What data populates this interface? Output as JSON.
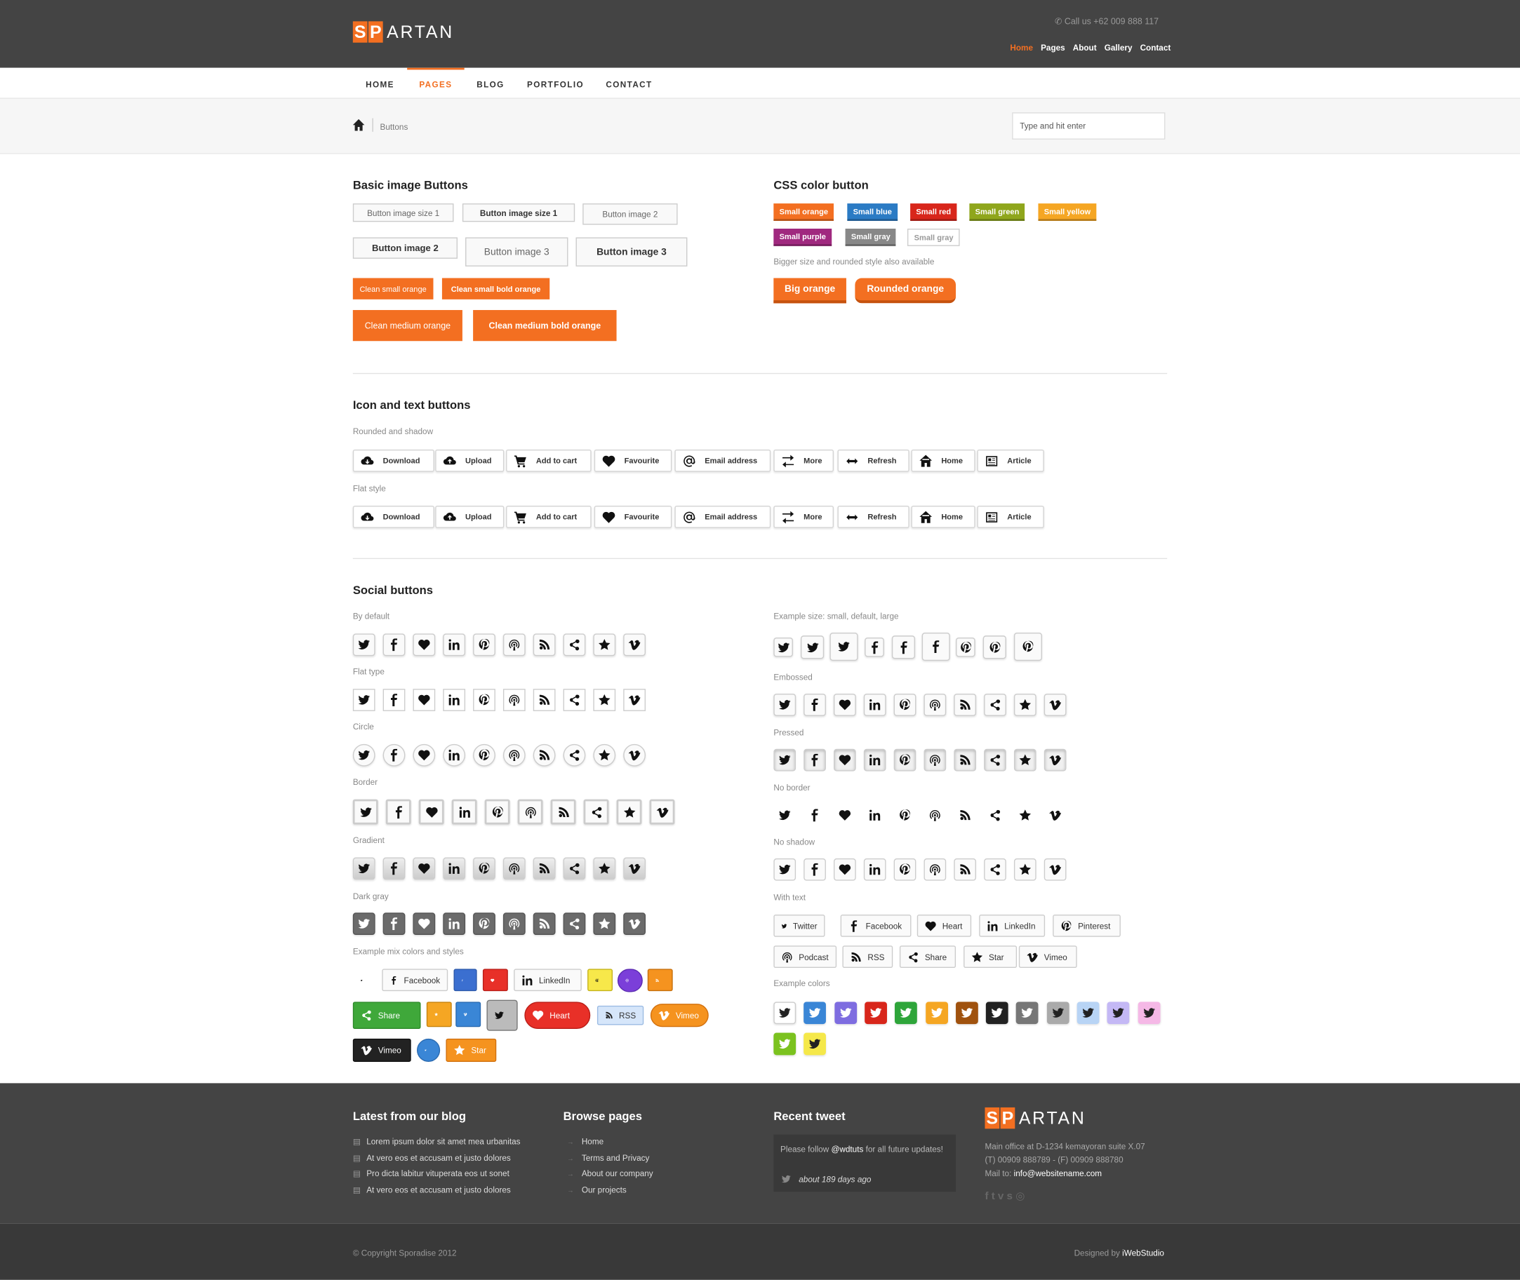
{
  "header": {
    "logo_highlight": "SP",
    "logo_rest": "ARTAN",
    "call": "Call us +62 009 888 117",
    "toplinks": [
      "Home",
      "Pages",
      "About",
      "Gallery",
      "Contact"
    ]
  },
  "nav": [
    "HOME",
    "PAGES",
    "BLOG",
    "PORTFOLIO",
    "CONTACT"
  ],
  "breadcrumb": "Buttons",
  "search": {
    "placeholder": "Type and hit enter"
  },
  "basic": {
    "title": "Basic image Buttons",
    "row1": [
      "Button image size 1",
      "Button image size 1",
      "Button image 2"
    ],
    "row2": [
      "Button image 2",
      "Button image 3",
      "Button image 3"
    ],
    "orange_small": [
      "Clean small orange",
      "Clean small bold orange"
    ],
    "orange_medium": [
      "Clean medium orange",
      "Clean medium bold orange"
    ]
  },
  "css": {
    "title": "CSS color button",
    "row1": [
      "Small orange",
      "Small blue",
      "Small red",
      "Small green",
      "Small yellow"
    ],
    "row2": [
      "Small purple",
      "Small gray",
      "Small gray"
    ],
    "note": "Bigger size and rounded style also available",
    "big": [
      "Big orange",
      "Rounded orange"
    ],
    "colors": {
      "orange": "#f36f21",
      "blue": "#2b7bc4",
      "red": "#d8261b",
      "green": "#8fa61c",
      "yellow": "#f5a623",
      "purple": "#a0297f",
      "gray": "#888888"
    }
  },
  "icontext": {
    "title": "Icon and text buttons",
    "sub1": "Rounded and shadow",
    "sub2": "Flat style",
    "buttons": [
      "Download",
      "Upload",
      "Add to cart",
      "Favourite",
      "Email address",
      "More",
      "Refresh",
      "Home",
      "Article"
    ]
  },
  "social": {
    "title": "Social buttons",
    "left_labels": [
      "By default",
      "Flat type",
      "Circle",
      "Border",
      "Gradient",
      "Dark gray",
      "Example mix colors and styles"
    ],
    "right_labels": [
      "Example size: small, default, large",
      "Embossed",
      "Pressed",
      "No border",
      "No shadow",
      "With text",
      "Example colors"
    ],
    "with_text": [
      "Twitter",
      "Facebook",
      "Heart",
      "LinkedIn",
      "Pinterest",
      "Podcast",
      "RSS",
      "Share",
      "Star",
      "Vimeo"
    ],
    "mix": [
      "Facebook",
      "LinkedIn",
      "Share",
      "Heart",
      "RSS",
      "Vimeo",
      "Vimeo",
      "Star"
    ],
    "example_colors": [
      "#ffffff",
      "#3a86d6",
      "#7e6de0",
      "#d8261b",
      "#2ea53a",
      "#f5a623",
      "#a0520e",
      "#222222",
      "#777777",
      "#aaaaaa",
      "#b8d4f5",
      "#c4b8f5",
      "#f5b8e6",
      "#7bc21f",
      "#f5e84a"
    ]
  },
  "footer": {
    "blog_title": "Latest from our blog",
    "blog": [
      "Lorem ipsum dolor sit amet mea urbanitas",
      "At vero eos et accusam et justo dolores",
      "Pro dicta labitur vituperata eos ut sonet",
      "At vero eos et accusam et justo dolores"
    ],
    "pages_title": "Browse pages",
    "pages": [
      "Home",
      "Terms and Privacy",
      "About our company",
      "Our projects"
    ],
    "tweet_title": "Recent tweet",
    "tweet_pre": "Please follow ",
    "tweet_handle": "@wdtuts",
    "tweet_post": " for all future updates!",
    "tweet_time": "about 189 days ago",
    "address1": "Main office at D-1234 kemayoran suite X.07",
    "address2": "(T) 00909 888789 - (F) 00909 888780",
    "mail_label": "Mail to: ",
    "mail": "info@websitename.com",
    "copyright": "© Copyright Sporadise 2012",
    "designed_label": "Designed by ",
    "designed_by": "iWebStudio"
  }
}
